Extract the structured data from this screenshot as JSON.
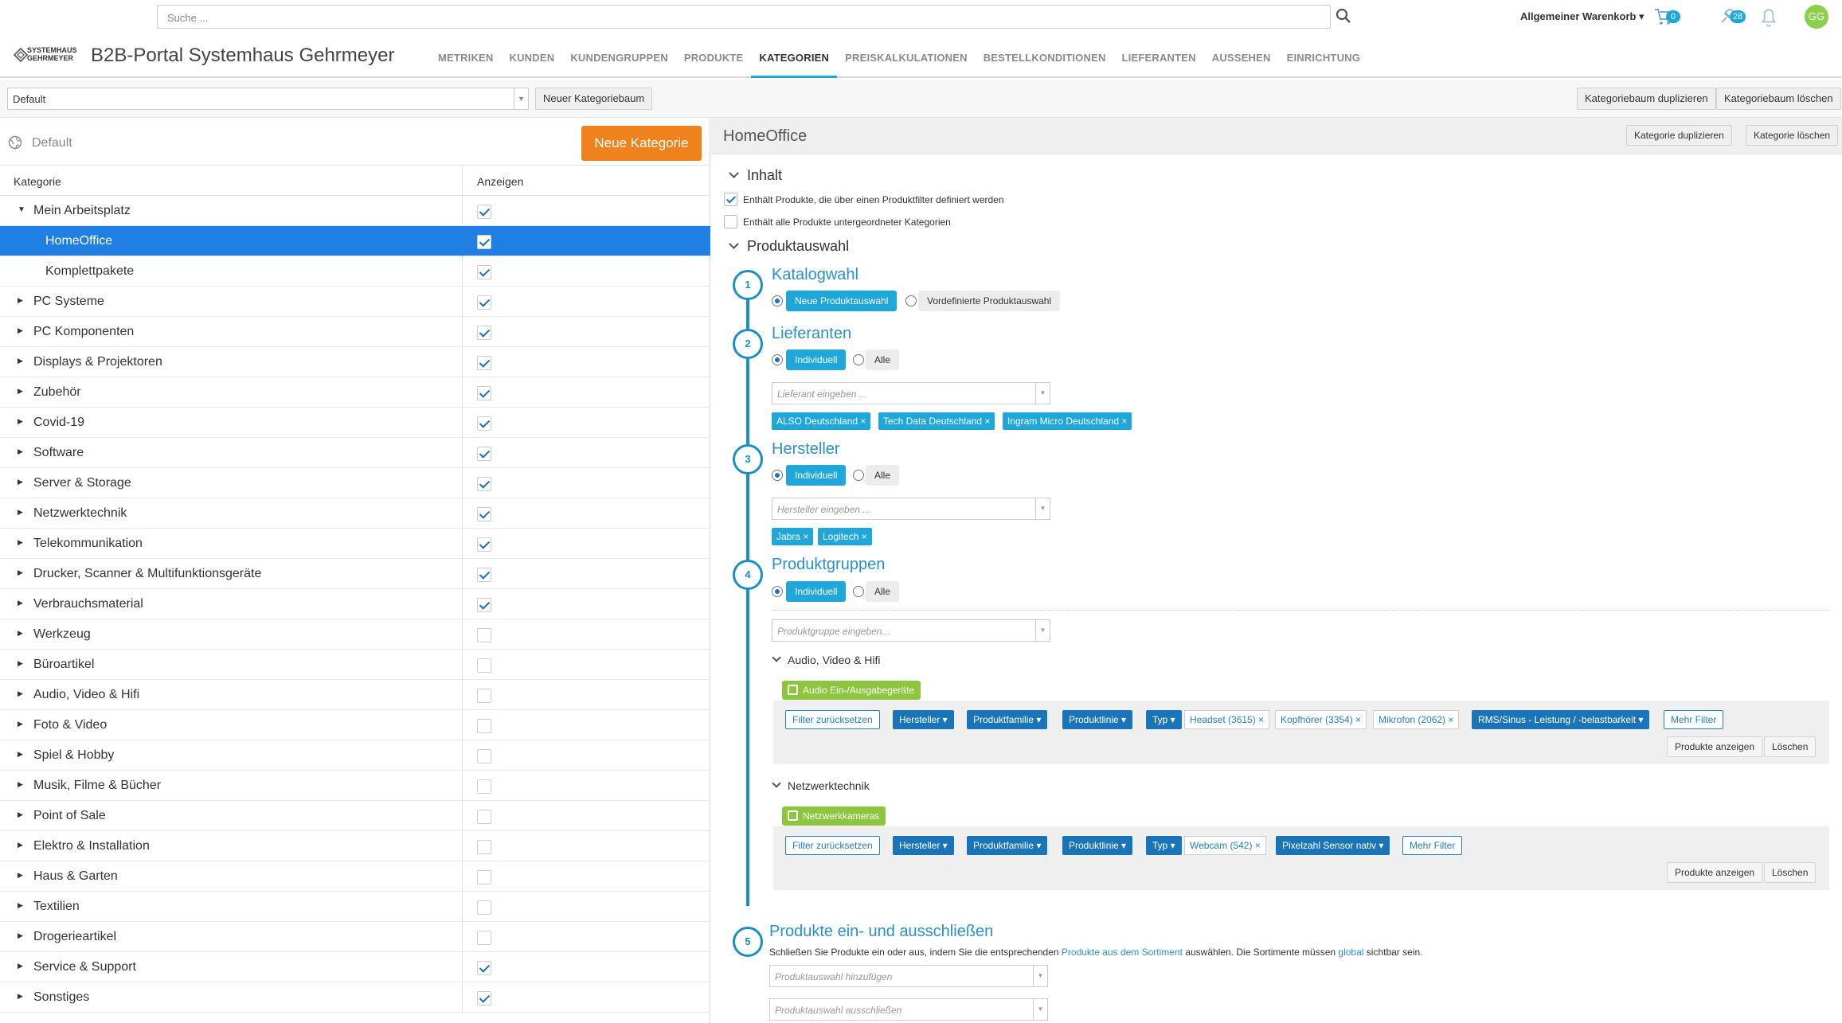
{
  "header": {
    "search_placeholder": "Suche ...",
    "cart_selector": "Allgemeiner Warenkorb ▾",
    "cart_count": "0",
    "notifications_count": "28",
    "avatar_initials": "GG"
  },
  "nav": {
    "logo_text_1": "SYSTEMHAUS",
    "logo_text_2": "GEHRMEYER",
    "title": "B2B-Portal Systemhaus Gehrmeyer",
    "items": [
      "METRIKEN",
      "KUNDEN",
      "KUNDENGRUPPEN",
      "PRODUKTE",
      "KATEGORIEN",
      "PREISKALKULATIONEN",
      "BESTELLKONDITIONEN",
      "LIEFERANTEN",
      "AUSSEHEN",
      "EINRICHTUNG"
    ],
    "active": "KATEGORIEN"
  },
  "toolbar": {
    "tree_value": "Default",
    "new_tree": "Neuer Kategoriebaum",
    "duplicate_tree": "Kategoriebaum duplizieren",
    "delete_tree": "Kategoriebaum löschen"
  },
  "left": {
    "title": "Default",
    "new_category": "Neue Kategorie",
    "col_category": "Kategorie",
    "col_show": "Anzeigen",
    "rows": [
      {
        "label": "Mein Arbeitsplatz",
        "checked": true,
        "level": 0,
        "expanded": true
      },
      {
        "label": "HomeOffice",
        "checked": true,
        "level": 1,
        "selected": true
      },
      {
        "label": "Komplettpakete",
        "checked": true,
        "level": 1
      },
      {
        "label": "PC Systeme",
        "checked": true,
        "level": 0
      },
      {
        "label": "PC Komponenten",
        "checked": true,
        "level": 0
      },
      {
        "label": "Displays & Projektoren",
        "checked": true,
        "level": 0
      },
      {
        "label": "Zubehör",
        "checked": true,
        "level": 0
      },
      {
        "label": "Covid-19",
        "checked": true,
        "level": 0
      },
      {
        "label": "Software",
        "checked": true,
        "level": 0
      },
      {
        "label": "Server & Storage",
        "checked": true,
        "level": 0
      },
      {
        "label": "Netzwerktechnik",
        "checked": true,
        "level": 0
      },
      {
        "label": "Telekommunikation",
        "checked": true,
        "level": 0
      },
      {
        "label": "Drucker, Scanner & Multifunktionsgeräte",
        "checked": true,
        "level": 0
      },
      {
        "label": "Verbrauchsmaterial",
        "checked": true,
        "level": 0
      },
      {
        "label": "Werkzeug",
        "checked": false,
        "level": 0
      },
      {
        "label": "Büroartikel",
        "checked": false,
        "level": 0
      },
      {
        "label": "Audio, Video & Hifi",
        "checked": false,
        "level": 0
      },
      {
        "label": "Foto & Video",
        "checked": false,
        "level": 0
      },
      {
        "label": "Spiel & Hobby",
        "checked": false,
        "level": 0
      },
      {
        "label": "Musik, Filme & Bücher",
        "checked": false,
        "level": 0
      },
      {
        "label": "Point of Sale",
        "checked": false,
        "level": 0
      },
      {
        "label": "Elektro & Installation",
        "checked": false,
        "level": 0
      },
      {
        "label": "Haus & Garten",
        "checked": false,
        "level": 0
      },
      {
        "label": "Textilien",
        "checked": false,
        "level": 0
      },
      {
        "label": "Drogerieartikel",
        "checked": false,
        "level": 0
      },
      {
        "label": "Service & Support",
        "checked": true,
        "level": 0
      },
      {
        "label": "Sonstiges",
        "checked": true,
        "level": 0
      }
    ]
  },
  "right": {
    "title": "HomeOffice",
    "duplicate": "Kategorie duplizieren",
    "delete": "Kategorie löschen",
    "inhalt": "Inhalt",
    "opt1": "Enthält Produkte, die über einen Produktfilter definiert werden",
    "opt2": "Enthält alle Produkte untergeordneter Kategorien",
    "produktauswahl": "Produktauswahl",
    "step1": {
      "num": "1",
      "title": "Katalogwahl",
      "opt_a": "Neue Produktauswahl",
      "opt_b": "Vordefinierte Produktauswahl"
    },
    "step2": {
      "num": "2",
      "title": "Lieferanten",
      "opt_a": "Individuell",
      "opt_b": "Alle",
      "placeholder": "Lieferant eingeben ...",
      "tags": [
        "ALSO Deutschland ×",
        "Tech Data Deutschland ×",
        "Ingram Micro Deutschland ×"
      ]
    },
    "step3": {
      "num": "3",
      "title": "Hersteller",
      "opt_a": "Individuell",
      "opt_b": "Alle",
      "placeholder": "Hersteller eingeben ...",
      "tags": [
        "Jabra ×",
        "Logitech ×"
      ]
    },
    "step4": {
      "num": "4",
      "title": "Produktgruppen",
      "opt_a": "Individuell",
      "opt_b": "Alle",
      "placeholder": "Produktgruppe eingeben...",
      "groups": [
        {
          "name": "Audio, Video & Hifi",
          "tag": "Audio Ein-/Ausgabegeräte",
          "reset": "Filter zurücksetzen",
          "dropdowns": [
            "Hersteller ▾",
            "Produktfamilie ▾",
            "Produktlinie ▾",
            "Typ ▾"
          ],
          "values": [
            "Headset (3615) ×",
            "Kopfhörer (3354) ×",
            "Mikrofon (2062) ×"
          ],
          "extra": "RMS/Sinus - Leistung / -belastbarkeit ▾",
          "more": "Mehr Filter",
          "show": "Produkte anzeigen",
          "delete": "Löschen"
        },
        {
          "name": "Netzwerktechnik",
          "tag": "Netzwerkkameras",
          "reset": "Filter zurücksetzen",
          "dropdowns": [
            "Hersteller ▾",
            "Produktfamilie ▾",
            "Produktlinie ▾",
            "Typ ▾"
          ],
          "values": [
            "Webcam (542) ×"
          ],
          "extra": "Pixelzahl Sensor nativ ▾",
          "more": "Mehr Filter",
          "show": "Produkte anzeigen",
          "delete": "Löschen"
        }
      ]
    },
    "step5": {
      "num": "5",
      "title": "Produkte ein- und ausschließen",
      "text_a": "Schließen Sie Produkte ein oder aus, indem Sie die entsprechenden ",
      "link_a": "Produkte aus dem Sortiment",
      "text_b": " auswählen. Die Sortimente müssen ",
      "link_b": "global",
      "text_c": " sichtbar sein.",
      "add_placeholder": "Produktauswahl hinzufügen",
      "exclude_placeholder": "Produktauswahl ausschließen"
    }
  },
  "colors": {
    "accent": "#1ea7d8",
    "selected_row": "#1f7fe2",
    "orange": "#f0821e",
    "green": "#8cc63f",
    "filter_dark": "#1a74b8"
  }
}
